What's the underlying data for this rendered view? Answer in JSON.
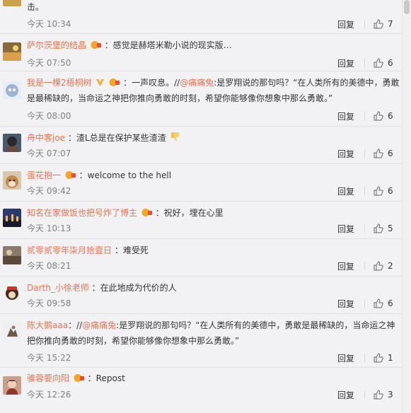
{
  "ui": {
    "reply_label": "回复"
  },
  "colors": {
    "username": "#eb7350",
    "time": "#808080",
    "background": "#f2f2f5"
  },
  "comments": [
    {
      "user": "",
      "text": "击。",
      "time": "今天 10:34",
      "likes": "7"
    },
    {
      "user": "萨尔茨堡的结晶",
      "text": "：感觉是赫塔米勒小说的现实版…",
      "time": "今天 07:50",
      "likes": "6"
    },
    {
      "user": "我是一棵2梧桐树",
      "text": "：一声叹息。//",
      "mention": "@痛痛兔",
      "text2": ":是罗翔说的那句吗？“在人类所有的美德中，勇敢",
      "line2": "是最稀缺的，当命运之神把你推向勇敢的时刻，希望你能够像你想象中那么勇敢。”",
      "time": "今天 08:00",
      "likes": "6"
    },
    {
      "user": "舟中客joe",
      "text": "：渣L总是在保护某些渣渣",
      "time": "今天 07:07",
      "likes": "6"
    },
    {
      "user": "蛋花抱一",
      "text": "：welcome to the hell",
      "time": "今天 09:42",
      "likes": "6"
    },
    {
      "user": "知名在家做饭也把号炸了博主",
      "text": "：祝好，埋在心里",
      "time": "今天 10:13",
      "likes": "5"
    },
    {
      "user": "贰零贰零年柒月拾壹日",
      "text": "：难受死",
      "time": "今天 08:21",
      "likes": "2"
    },
    {
      "user": "Darth_小徐老师",
      "text": "：在此地成为代价的人",
      "time": "今天 09:58",
      "likes": "6"
    },
    {
      "user": "陈大鹅aaa",
      "text": "：//",
      "mention": "@痛痛兔",
      "text2": ":是罗翔说的那句吗？“在人类所有的美德中，勇敢是最稀缺的，当命运之神",
      "line2": "把你推向勇敢的时刻，希望你能够像你想象中那么勇敢。”",
      "time": "今天 15:22",
      "likes": "1"
    },
    {
      "user": "骓蓉要向阳",
      "text": "：Repost",
      "time": "今天 12:26",
      "likes": "3"
    }
  ]
}
